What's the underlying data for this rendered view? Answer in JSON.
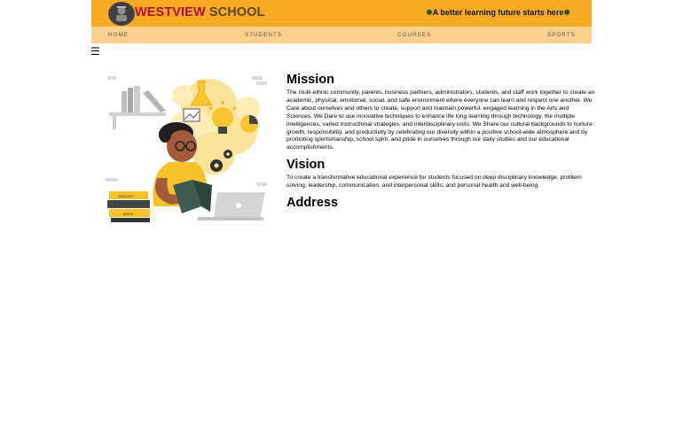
{
  "header": {
    "brand_first": "WESTVIEW",
    "brand_second": " SCHOOL",
    "tagline": "A better learning future starts here",
    "ornament": "❅",
    "bg_color": "#f6ab23",
    "brand_color": "#b0103a"
  },
  "nav": {
    "items": [
      "HOME",
      "STUDENTS",
      "COURSES",
      "SPORTS"
    ],
    "bg_color": "#fbd08c"
  },
  "menu_icon": "☰",
  "sections": {
    "mission": {
      "title": "Mission",
      "text": "The multi-ethnic community, parents, business partners, administrators, students, and staff work together to create an academic, physical, emotional, social, and safe environment where everyone can learn and respect one another. We Care about ourselves and others to create, support and maintain powerful, engaged learning in the Arts and Sciences. We Dare to use innovative techniques to enhance life long learning through technology, the multiple intelligences, varied instructional strategies, and interdisciplinary units. We Share our cultural backgrounds to nurture growth, responsibility, and productivity by celebrating our diversity within a positive school-wide atmosphere and by promoting sportsmanship, school spirit, and pride in ourselves through our daily studies and our educational accomplishments."
    },
    "vision": {
      "title": "Vision",
      "text": "To create a transformative educational experience for students focused on deep disciplinary knowledge; problem solving; leadership, communication, and interpersonal skills; and personal health and well-being."
    },
    "address": {
      "title": "Address"
    }
  },
  "illustration": {
    "book_labels": [
      "ENGLISH",
      "MATH"
    ]
  }
}
